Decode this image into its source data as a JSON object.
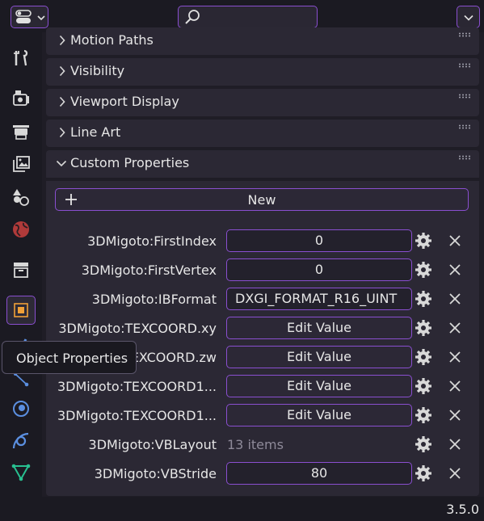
{
  "search": {
    "value": ""
  },
  "sidebar": {
    "tabs": [
      {
        "name": "tool"
      },
      {
        "name": "render"
      },
      {
        "name": "output"
      },
      {
        "name": "view-layer"
      },
      {
        "name": "scene"
      },
      {
        "name": "world"
      },
      {
        "name": "collection"
      },
      {
        "name": "object",
        "active": true
      },
      {
        "name": "modifiers"
      },
      {
        "name": "particles"
      },
      {
        "name": "physics"
      },
      {
        "name": "constraints"
      },
      {
        "name": "data"
      }
    ]
  },
  "panels": {
    "motion_paths": "Motion Paths",
    "visibility": "Visibility",
    "viewport_display": "Viewport Display",
    "line_art": "Line Art",
    "custom_properties": "Custom Properties"
  },
  "custom_properties": {
    "new_label": "New",
    "rows": [
      {
        "label": "3DMigoto:FirstIndex",
        "value": "0"
      },
      {
        "label": "3DMigoto:FirstVertex",
        "value": "0"
      },
      {
        "label": "3DMigoto:IBFormat",
        "value": "DXGI_FORMAT_R16_UINT"
      },
      {
        "label": "3DMigoto:TEXCOORD.xy",
        "value": "Edit Value"
      },
      {
        "label": "3DMigoto:TEXCOORD.zw",
        "value": "Edit Value"
      },
      {
        "label": "3DMigoto:TEXCOORD1...",
        "value": "Edit Value"
      },
      {
        "label": "3DMigoto:TEXCOORD1...",
        "value": "Edit Value"
      },
      {
        "label": "3DMigoto:VBLayout",
        "value": "13 items"
      },
      {
        "label": "3DMigoto:VBStride",
        "value": "80"
      }
    ]
  },
  "tooltip": {
    "text": "Object Properties"
  },
  "status": {
    "version": "3.5.0"
  },
  "colors": {
    "accent": "#8a4fd0",
    "active_icon": "#f0a038"
  }
}
